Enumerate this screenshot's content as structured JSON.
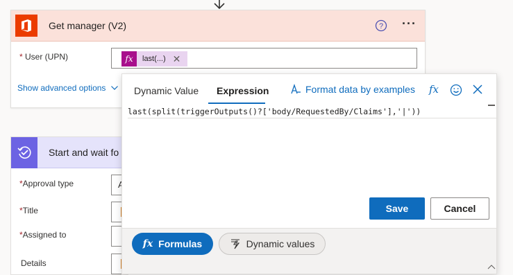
{
  "card1": {
    "title": "Get manager (V2)",
    "user_label": "User (UPN)",
    "required_mark": "*",
    "token_label": "last(...)",
    "token_close": "✕",
    "advanced_link": "Show advanced options",
    "more": "···",
    "colors": {
      "header_bg": "#fbe1da",
      "icon_bg": "#eb3c00"
    },
    "icons": [
      "office365-icon",
      "help-icon",
      "more-icon",
      "chevron-down-icon"
    ]
  },
  "card2": {
    "title": "Start and wait fo",
    "fields": [
      {
        "label": "Approval type",
        "required": true,
        "value": "A"
      },
      {
        "label": "Title",
        "required": true
      },
      {
        "label": "Assigned to",
        "required": true
      },
      {
        "label": "Details",
        "required": false
      }
    ],
    "colors": {
      "header_bg": "#e5e3fb",
      "icon_bg": "#6c63e3"
    }
  },
  "popup": {
    "tabs": [
      {
        "label": "Dynamic Value",
        "active": false
      },
      {
        "label": "Expression",
        "active": true
      }
    ],
    "format_link": "Format data by examples",
    "expression": "last(split(triggerOutputs()?['body/RequestedBy/Claims'],'|'))",
    "save_label": "Save",
    "cancel_label": "Cancel",
    "formulas_label": "Formulas",
    "dynamic_values_label": "Dynamic values",
    "fx_glyph": "fx",
    "colors": {
      "accent": "#0f6cbd"
    },
    "icons": [
      "format-data-icon",
      "fx-icon",
      "smiley-icon",
      "close-icon",
      "lightning-icon"
    ]
  }
}
